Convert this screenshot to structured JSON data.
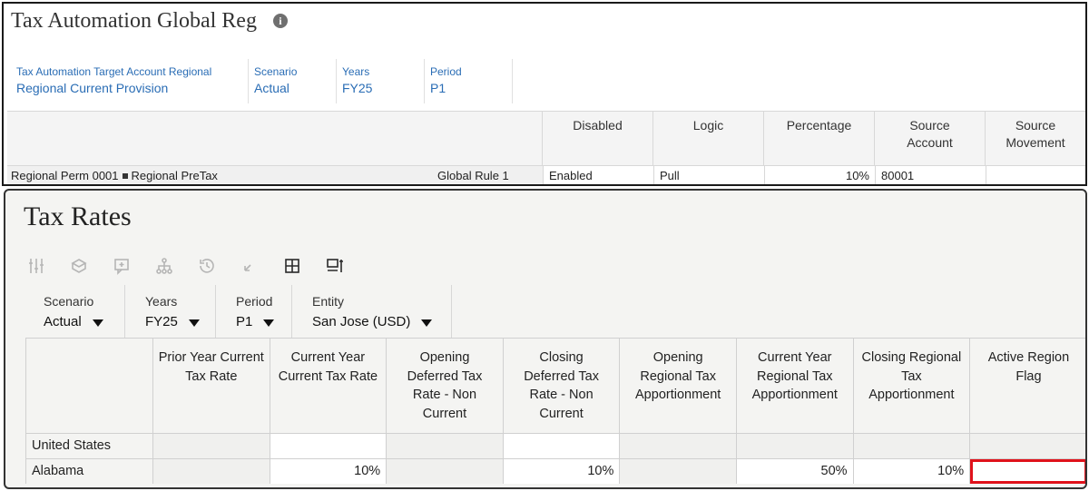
{
  "top_form": {
    "title": "Tax Automation Global Reg",
    "pov": [
      {
        "label": "Tax Automation Target Account Regional",
        "value": "Regional Current Provision"
      },
      {
        "label": "Scenario",
        "value": "Actual"
      },
      {
        "label": "Years",
        "value": "FY25"
      },
      {
        "label": "Period",
        "value": "P1"
      }
    ],
    "columns": [
      "Disabled",
      "Logic",
      "Percentage",
      "Source Account",
      "Source Movement"
    ],
    "row": {
      "label_left": "Regional Perm 0001",
      "label_right": "Regional PreTax",
      "rule": "Global Rule 1",
      "values": [
        "Enabled",
        "Pull",
        "10%",
        "80001",
        ""
      ]
    }
  },
  "tax_rates": {
    "title": "Tax Rates",
    "toolbar": [
      "adjust-icon",
      "cube-icon",
      "add-comment-icon",
      "hierarchy-icon",
      "history-icon",
      "undo-icon",
      "grid-icon",
      "freeze-icon"
    ],
    "pov": [
      {
        "label": "Scenario",
        "value": "Actual"
      },
      {
        "label": "Years",
        "value": "FY25"
      },
      {
        "label": "Period",
        "value": "P1"
      },
      {
        "label": "Entity",
        "value": "San Jose (USD)"
      }
    ],
    "columns": [
      "Prior Year Current Tax Rate",
      "Current Year Current Tax Rate",
      "Opening Deferred Tax Rate - Non Current",
      "Closing Deferred Tax Rate - Non Current",
      "Opening Regional Tax Apportionment",
      "Current Year Regional Tax Apportionment",
      "Closing Regional Tax Apportionment",
      "Active Region Flag"
    ],
    "rows": [
      {
        "label": "United States",
        "values": [
          "",
          "",
          "",
          "",
          "",
          "",
          "",
          ""
        ]
      },
      {
        "label": "Alabama",
        "values": [
          "",
          "10%",
          "",
          "10%",
          "",
          "50%",
          "10%",
          ""
        ]
      }
    ]
  },
  "colors": {
    "highlight": "#e0121b",
    "pov_link": "#2a6db5"
  }
}
